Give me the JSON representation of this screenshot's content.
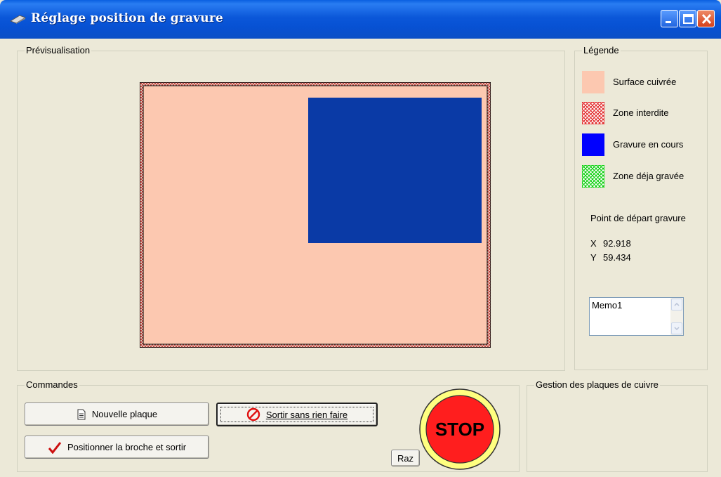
{
  "window": {
    "title": "Réglage position de gravure",
    "controls": [
      "minimize-icon",
      "maximize-icon",
      "close-icon"
    ],
    "title_color": "#0b57d9"
  },
  "preview": {
    "label": "Prévisualisation",
    "plate_color": "#fcc8b0",
    "engraving_color": "#0a3aa6"
  },
  "legend": {
    "label": "Légende",
    "items": [
      {
        "label": "Surface cuivrée",
        "icon": "solid-swatch-icon",
        "color": "#fcc8b0"
      },
      {
        "label": "Zone interdite",
        "icon": "red-crosshatch-swatch-icon",
        "color": "#e02020"
      },
      {
        "label": "Gravure en cours",
        "icon": "solid-swatch-icon",
        "color": "#0000ff"
      },
      {
        "label": "Zone déja gravée",
        "icon": "green-crosshatch-swatch-icon",
        "color": "#00cc00"
      }
    ],
    "start_point_label": "Point de départ gravure",
    "x_label": "X",
    "x_value": "92.918",
    "y_label": "Y",
    "y_value": "59.434",
    "memo_text": "Memo1"
  },
  "commands": {
    "label": "Commandes",
    "new_plate": "Nouvelle plaque",
    "exit_no_action": "Sortir sans rien faire",
    "position_and_exit": "Positionner la broche et sortir",
    "reset": "Raz",
    "stop": "STOP"
  },
  "plates": {
    "label": "Gestion des plaques de cuivre"
  }
}
